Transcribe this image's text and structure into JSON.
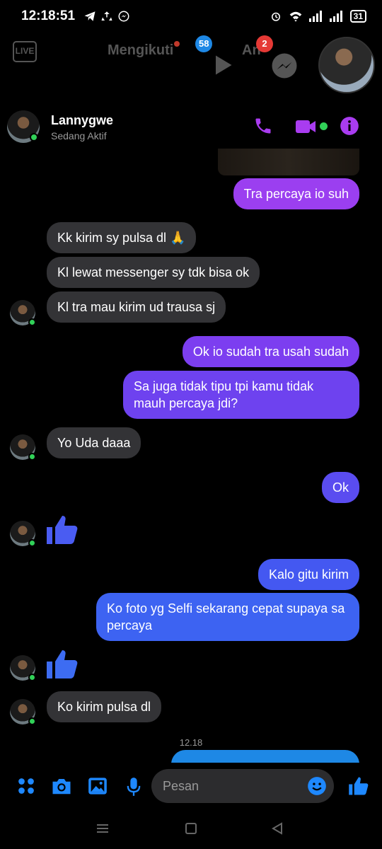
{
  "status_bar": {
    "time": "12:18:51",
    "battery": "31"
  },
  "bg_app": {
    "tab_following": "Mengikuti",
    "tab_other": "An",
    "badge_video": "58",
    "badge_messenger": "2",
    "live_label": "LIVE"
  },
  "chat": {
    "name": "Lannygwe",
    "status": "Sedang Aktif"
  },
  "messages": {
    "m1": "Tra percaya io suh",
    "m2": "Kk kirim sy pulsa dl 🙏",
    "m3": "Kl lewat messenger sy tdk bisa ok",
    "m4": "Kl tra mau kirim ud trausa sj",
    "m5": "Ok io sudah tra usah sudah",
    "m6": "Sa juga tidak tipu tpi kamu tidak mauh percaya jdi?",
    "m7": "Yo Uda daaa",
    "m8": "Ok",
    "m9": "Kalo gitu kirim",
    "m10": "Ko foto yg Selfi sekarang cepat supaya sa percaya",
    "m11": "Ko kirim pulsa dl",
    "timestamp": "12.18"
  },
  "composer": {
    "placeholder": "Pesan"
  },
  "colors": {
    "purple": "#9b3ff0",
    "violet": "#6a44ef",
    "blue": "#3d63f2",
    "accent_icon": "#1e88ff",
    "header_icon": "#a93cf0",
    "online": "#31d158"
  }
}
